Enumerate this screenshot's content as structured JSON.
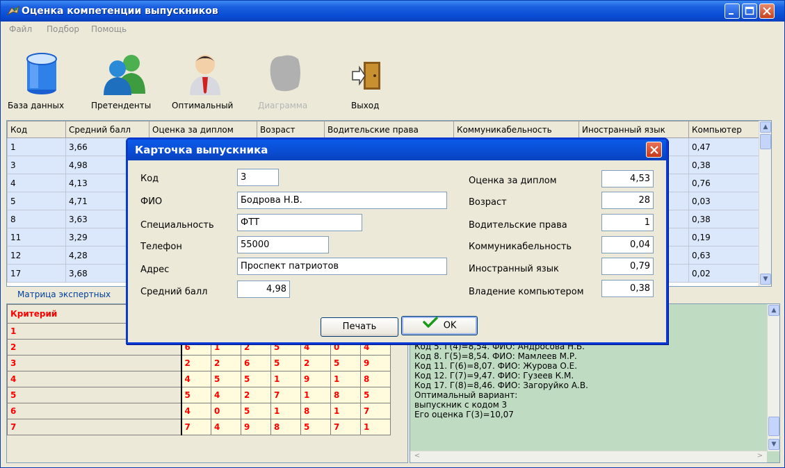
{
  "window": {
    "title": "Оценка компетенции выпускников"
  },
  "menu": [
    "Файл",
    "Подбор",
    "Помощь"
  ],
  "toolbar": {
    "database": "База данных",
    "applicants": "Претенденты",
    "optimal": "Оптимальный",
    "diagram": "Диаграмма",
    "exit": "Выход"
  },
  "grid": {
    "columns": [
      "Код",
      "Средний балл",
      "Оценка за диплом",
      "Возраст",
      "Водительские права",
      "Коммуникабельность",
      "Иностранный язык",
      "Компьютер"
    ],
    "rows": [
      {
        "code": "1",
        "avg": "3,66",
        "computer": "0,47"
      },
      {
        "code": "3",
        "avg": "4,98",
        "computer": "0,38"
      },
      {
        "code": "4",
        "avg": "4,13",
        "computer": "0,76"
      },
      {
        "code": "5",
        "avg": "4,71",
        "computer": "0,03"
      },
      {
        "code": "8",
        "avg": "3,63",
        "computer": "0,38"
      },
      {
        "code": "11",
        "avg": "3,29",
        "computer": "0,19"
      },
      {
        "code": "12",
        "avg": "4,28",
        "computer": "0,63"
      },
      {
        "code": "17",
        "avg": "3,68",
        "computer": "0,02"
      }
    ]
  },
  "matrix": {
    "group_label": "Матрица экспертных",
    "header": "Критерий",
    "rows": [
      {
        "label": "1",
        "values": []
      },
      {
        "label": "2",
        "values": [
          "6",
          "1",
          "2",
          "5",
          "4",
          "0",
          "4"
        ]
      },
      {
        "label": "3",
        "values": [
          "2",
          "2",
          "6",
          "5",
          "2",
          "5",
          "9"
        ]
      },
      {
        "label": "4",
        "values": [
          "4",
          "5",
          "5",
          "1",
          "9",
          "1",
          "8"
        ]
      },
      {
        "label": "5",
        "values": [
          "5",
          "4",
          "2",
          "7",
          "1",
          "8",
          "5"
        ]
      },
      {
        "label": "6",
        "values": [
          "4",
          "0",
          "5",
          "1",
          "8",
          "1",
          "7"
        ]
      },
      {
        "label": "7",
        "values": [
          "7",
          "4",
          "9",
          "8",
          "5",
          "7",
          "1"
        ]
      }
    ]
  },
  "memo": {
    "lines": [
      "Код 5. Г(4)=8,54. ФИО: Андросова Н.Б.",
      "Код 8. Г(5)=8,54. ФИО: Мамлеев М.Р.",
      "Код 11. Г(6)=8,07. ФИО: Журова О.Е.",
      "Код 12. Г(7)=9,47. ФИО: Гузеев К.М.",
      "Код 17. Г(8)=8,46. ФИО: Загоруйко А.В.",
      "Оптимальный вариант:",
      "выпускник с кодом 3",
      "Его оценка Г(3)=10,07"
    ]
  },
  "dialog": {
    "title": "Карточка выпускника",
    "labels": {
      "code": "Код",
      "fio": "ФИО",
      "specialty": "Специальность",
      "phone": "Телефон",
      "address": "Адрес",
      "avg": "Средний балл",
      "diploma": "Оценка за диплом",
      "age": "Возраст",
      "license": "Водительские права",
      "communication": "Коммуникабельность",
      "language": "Иностранный язык",
      "computer": "Владение компьютером"
    },
    "values": {
      "code": "3",
      "fio": "Бодрова Н.В.",
      "specialty": "ФТТ",
      "phone": "55000",
      "address": "Проспект патриотов",
      "avg": "4,98",
      "diploma": "4,53",
      "age": "28",
      "license": "1",
      "communication": "0,04",
      "language": "0,79",
      "computer": "0,38"
    },
    "print_button": "Печать",
    "ok_button": "OK"
  }
}
